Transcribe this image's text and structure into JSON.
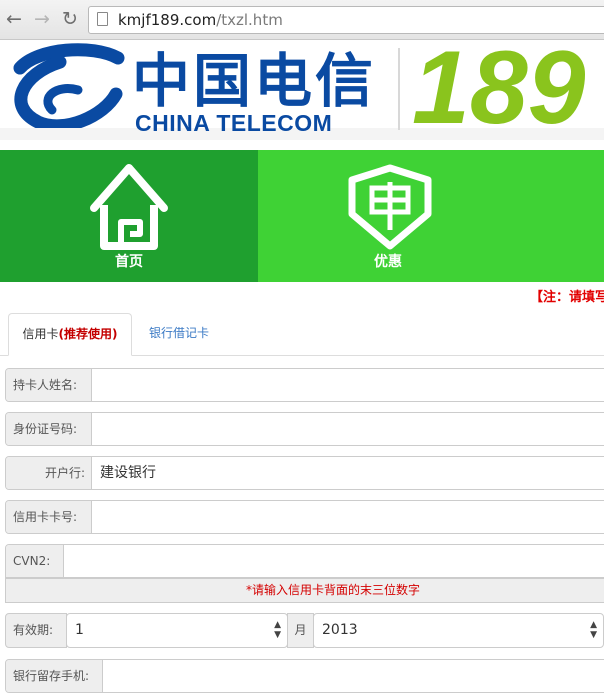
{
  "browser": {
    "url_host": "kmjf189.com",
    "url_path": "/txzl.htm"
  },
  "banner": {
    "cn": "中国电信",
    "en": "CHINA TELECOM",
    "number": "189",
    "colors": {
      "blue": "#0a4aa2",
      "green": "#8ac41d"
    }
  },
  "nav": {
    "home_label": "首页",
    "promo_label": "优惠",
    "colors": {
      "home": "#1fa02f",
      "promo": "#3fd235"
    }
  },
  "notice": "【注：请填写",
  "tabs": {
    "credit_label": "信用卡",
    "credit_hint": "(推荐使用)",
    "debit_label": "银行借记卡"
  },
  "form": {
    "holder_name_label": "持卡人姓名:",
    "holder_name_value": "",
    "id_number_label": "身份证号码:",
    "id_number_value": "",
    "bank_label": "开户行:",
    "bank_value": "建设银行",
    "card_number_label": "信用卡卡号:",
    "card_number_value": "",
    "cvn2_label": "CVN2:",
    "cvn2_value": "",
    "cvn2_hint": "*请输入信用卡背面的末三位数字",
    "expiry_label": "有效期:",
    "expiry_month_value": "1",
    "month_label": "月",
    "expiry_year_value": "2013",
    "phone_label": "银行留存手机:",
    "phone_value": ""
  }
}
